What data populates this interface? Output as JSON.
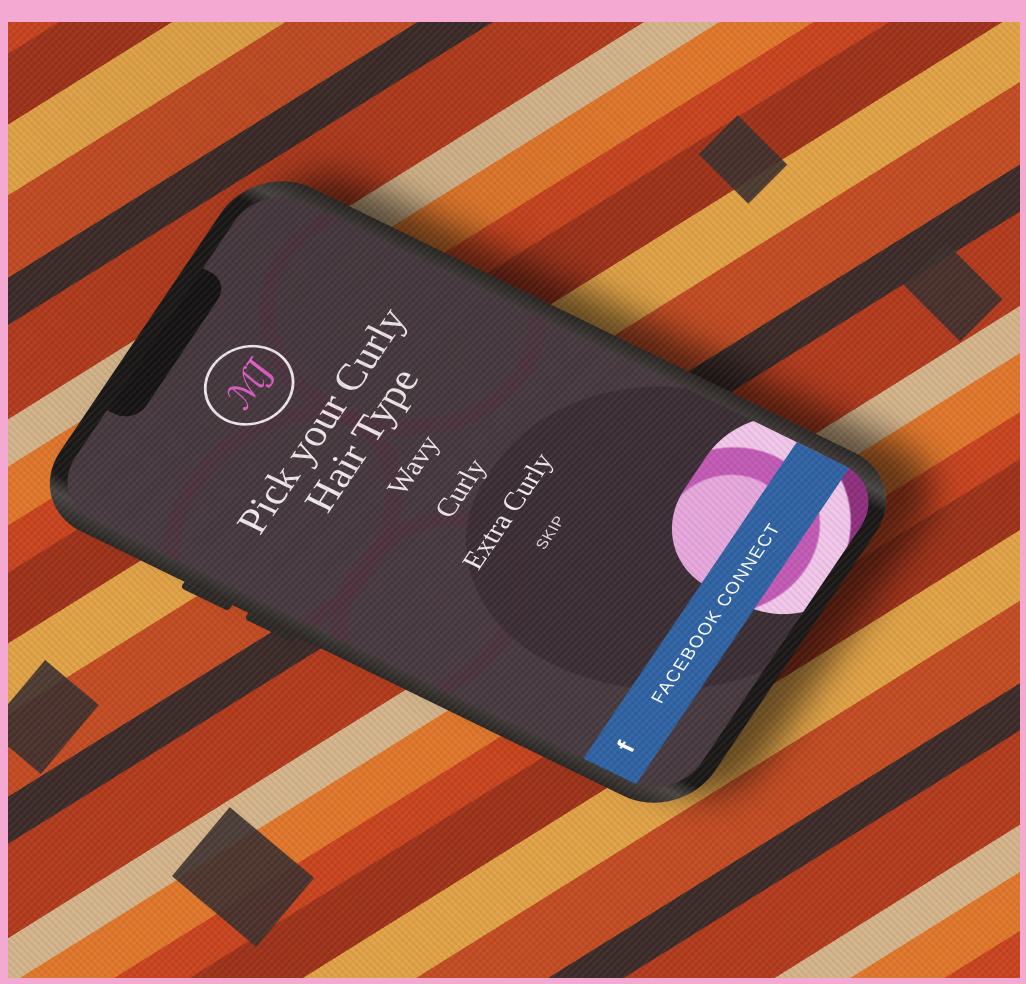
{
  "app": {
    "logo_text": "ℳJ",
    "title_line1": "Pick your Curly",
    "title_line2": "Hair Type",
    "options": [
      "Wavy",
      "Curly",
      "Extra Curly"
    ],
    "skip_label": "SKIP",
    "facebook_label": "FACEBOOK CONNECT",
    "facebook_icon": "f"
  },
  "colors": {
    "page_border": "#f4a9d2",
    "screen_background": "#47393f",
    "logo_accent": "#e35fc6",
    "facebook_blue": "#2f62a3"
  },
  "icons": {
    "logo": "brand-monogram-icon",
    "facebook": "facebook-icon"
  }
}
